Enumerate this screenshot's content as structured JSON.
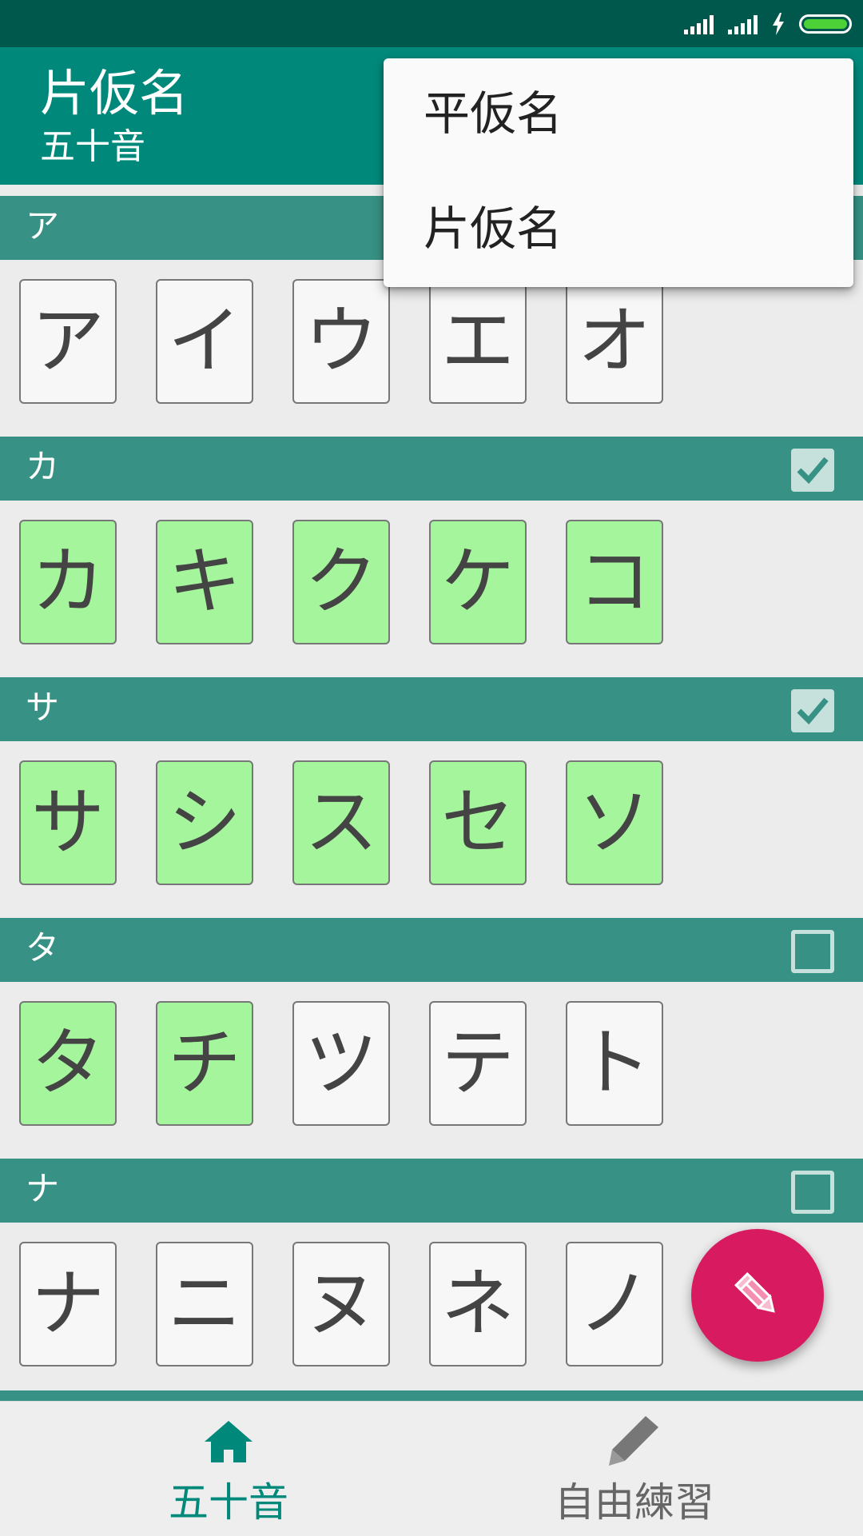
{
  "colors": {
    "status_bar": "#00574b",
    "app_bar": "#00897b",
    "section_header": "#379184",
    "learned_cell": "#a5f59c",
    "fab": "#d81b60",
    "nav_active": "#00897b",
    "nav_inactive": "#666666",
    "battery": "#4cd137"
  },
  "status_bar": {
    "icons": [
      "signal-icon",
      "signal-icon",
      "charging-icon",
      "battery-icon"
    ]
  },
  "app_bar": {
    "title": "片仮名",
    "subtitle": "五十音"
  },
  "menu": {
    "items": [
      "平仮名",
      "片仮名"
    ]
  },
  "sections": [
    {
      "label": "ア",
      "checkbox": "none",
      "cells": [
        {
          "char": "ア",
          "learned": false
        },
        {
          "char": "イ",
          "learned": false
        },
        {
          "char": "ウ",
          "learned": false
        },
        {
          "char": "エ",
          "learned": false
        },
        {
          "char": "オ",
          "learned": false
        }
      ]
    },
    {
      "label": "カ",
      "checkbox": "checked",
      "cells": [
        {
          "char": "カ",
          "learned": true
        },
        {
          "char": "キ",
          "learned": true
        },
        {
          "char": "ク",
          "learned": true
        },
        {
          "char": "ケ",
          "learned": true
        },
        {
          "char": "コ",
          "learned": true
        }
      ]
    },
    {
      "label": "サ",
      "checkbox": "checked",
      "cells": [
        {
          "char": "サ",
          "learned": true
        },
        {
          "char": "シ",
          "learned": true
        },
        {
          "char": "ス",
          "learned": true
        },
        {
          "char": "セ",
          "learned": true
        },
        {
          "char": "ソ",
          "learned": true
        }
      ]
    },
    {
      "label": "タ",
      "checkbox": "unchecked",
      "cells": [
        {
          "char": "タ",
          "learned": true
        },
        {
          "char": "チ",
          "learned": true
        },
        {
          "char": "ツ",
          "learned": false
        },
        {
          "char": "テ",
          "learned": false
        },
        {
          "char": "ト",
          "learned": false
        }
      ]
    },
    {
      "label": "ナ",
      "checkbox": "unchecked",
      "cells": [
        {
          "char": "ナ",
          "learned": false
        },
        {
          "char": "ニ",
          "learned": false
        },
        {
          "char": "ヌ",
          "learned": false
        },
        {
          "char": "ネ",
          "learned": false
        },
        {
          "char": "ノ",
          "learned": false
        }
      ]
    }
  ],
  "fab": {
    "icon": "pencil-icon"
  },
  "bottom_nav": {
    "items": [
      {
        "label": "五十音",
        "icon": "home-icon",
        "active": true
      },
      {
        "label": "自由練習",
        "icon": "pencil-icon",
        "active": false
      }
    ]
  }
}
